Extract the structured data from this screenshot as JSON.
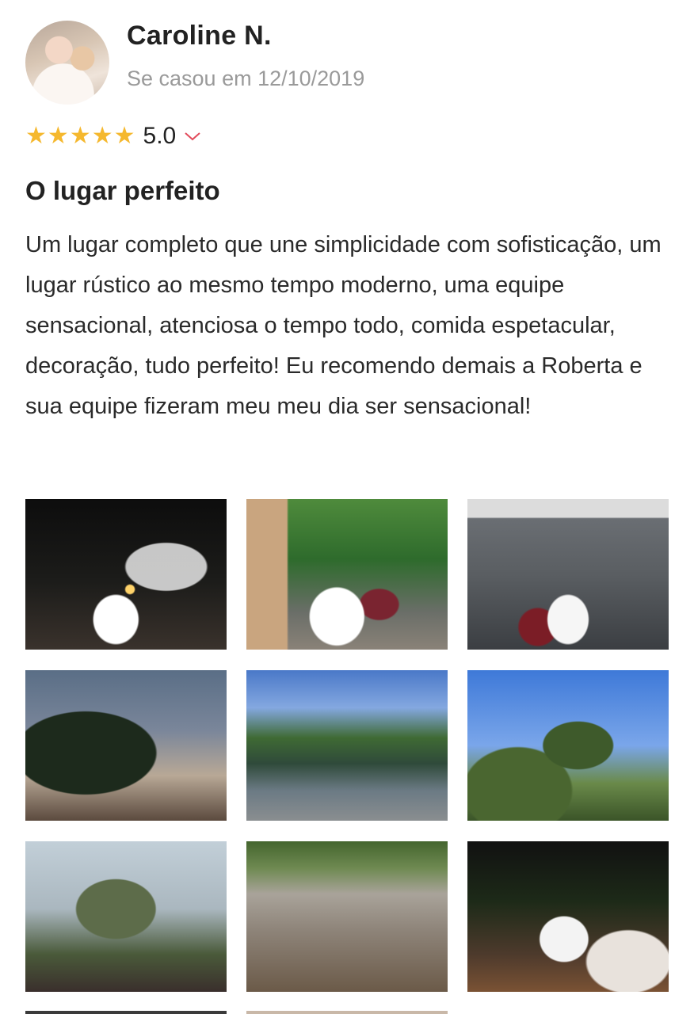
{
  "review": {
    "author": "Caroline N.",
    "married_text": "Se casou em 12/10/2019",
    "rating": 5,
    "rating_text": "5.0",
    "title": "O lugar perfeito",
    "body": "Um lugar completo que une simplicidade com sofisticação, um lugar rústico ao mesmo tempo moderno, uma equipe sensacional, atenciosa o tempo todo, comida espetacular, decoração, tudo perfeito! Eu recomendo demais a Roberta e sua equipe fizeram meu meu dia ser sensacional!"
  },
  "icons": {
    "star": "star-icon",
    "chevron": "chevron-down-icon"
  },
  "colors": {
    "star": "#f5b82e",
    "chevron": "#e24b5b",
    "muted_text": "#9a9a9a"
  },
  "photos": [
    {
      "subject": "bride-veil-night"
    },
    {
      "subject": "ceremony-altar"
    },
    {
      "subject": "guests-ceremony"
    },
    {
      "subject": "pergola-sunset"
    },
    {
      "subject": "lake-reflection"
    },
    {
      "subject": "palm-trees-sky"
    },
    {
      "subject": "outdoor-ceremony-guests"
    },
    {
      "subject": "wooden-benches"
    },
    {
      "subject": "couple-kiss-night"
    }
  ]
}
